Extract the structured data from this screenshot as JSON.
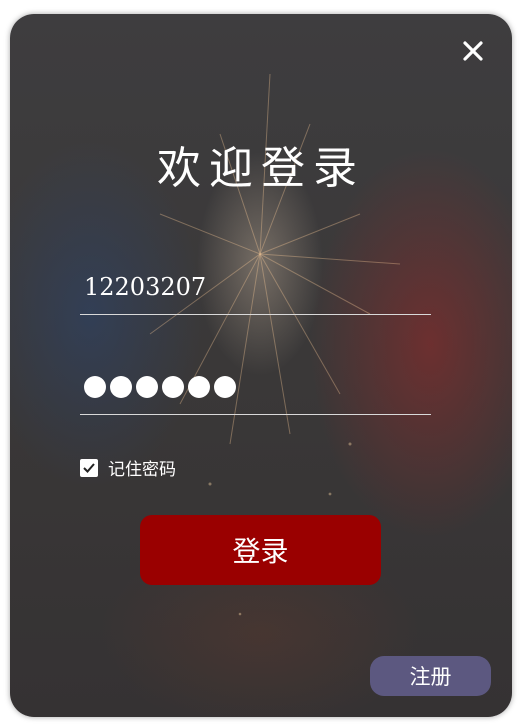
{
  "window": {
    "title": "欢迎登录"
  },
  "login_form": {
    "username_value": "12203207",
    "password_masked_length": 6,
    "remember_label": "记住密码",
    "remember_checked": true,
    "login_label": "登录"
  },
  "footer": {
    "register_label": "注册"
  },
  "icons": {
    "close": "close-icon",
    "check": "checkmark-icon"
  },
  "colors": {
    "login_button": "#9a0000",
    "register_button": "#5c5880",
    "text": "#ffffff"
  }
}
